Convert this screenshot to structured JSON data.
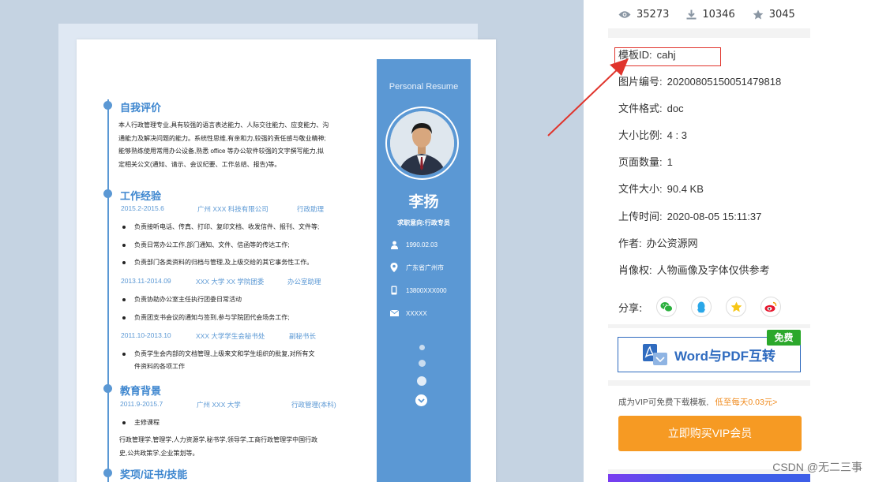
{
  "stats": {
    "views": "35273",
    "downloads": "10346",
    "favorites": "3045"
  },
  "details": [
    {
      "label": "模板ID:",
      "value": "cahj"
    },
    {
      "label": "图片编号:",
      "value": "20200805150051479818"
    },
    {
      "label": "文件格式:",
      "value": "doc"
    },
    {
      "label": "大小比例:",
      "value": "4 : 3"
    },
    {
      "label": "页面数量:",
      "value": "1"
    },
    {
      "label": "文件大小:",
      "value": "90.4 KB"
    },
    {
      "label": "上传时间:",
      "value": "2020-08-05 15:11:37"
    },
    {
      "label": "作者:",
      "value": "办公资源网"
    },
    {
      "label": "肖像权:",
      "value": "人物画像及字体仅供参考"
    }
  ],
  "share": {
    "label": "分享:",
    "targets": [
      "wechat-icon",
      "qq-icon",
      "qzone-icon",
      "weibo-icon"
    ]
  },
  "convert": {
    "label": "Word与PDF互转",
    "badge": "免费"
  },
  "vip": {
    "note": "成为VIP可免费下载模板,",
    "highlight": "低至每天0.03元>",
    "button": "立即购买VIP会员"
  },
  "watermark": "CSDN @无二三事",
  "colors": {
    "accent": "#5b98d4",
    "vip_orange": "#f69a23",
    "highlight_red": "#e0342c",
    "free_green": "#2ba82b"
  },
  "resume": {
    "side_title": "Personal Resume",
    "name": "李扬",
    "intent": "求职意向:行政专员",
    "birth": "1990.02.03",
    "location": "广东省广州市",
    "phone": "13800XXX000",
    "email": "XXXXX",
    "sections": {
      "self_eval": {
        "title": "自我评价",
        "lines": [
          "本人行政管理专业,具有较强的语言表达能力、人际交往能力、应变能力、沟",
          "通能力及解决问题的能力。系统性思维,有亲和力,较强的责任感与敬业精神;",
          "能够熟练使用常用办公设备,熟悉 office 等办公软件较强的文字撰写能力,拟",
          "定相关公文(通知、请示、会议纪要、工作总结、报告)等。"
        ]
      },
      "work": {
        "title": "工作经验",
        "jobs": [
          {
            "period": "2015.2-2015.6",
            "org": "广州 XXX 科技有限公司",
            "role": "行政助理",
            "items": [
              "负责接听电话、传真、打印、复印文档、收发信件、报刊、文件等;",
              "负责日常办公工作,部门通知、文件、信函等的传达工作;",
              "负责部门各类资料的归档与管理,及上级交给的其它事务性工作。"
            ]
          },
          {
            "period": "2013.11-2014.09",
            "org": "XXX 大学 XX 学院团委",
            "role": "办公室助理",
            "items": [
              "负责协助办公室主任执行团委日常活动",
              "负责团支书会议的通知与签到,参与学院团代会场务工作;"
            ]
          },
          {
            "period": "2011.10-2013.10",
            "org": "XXX 大学学生会秘书处",
            "role": "副秘书长",
            "items": [
              "负责学生会内部的文档管理,上级来文和学生组织的批复,对所有文",
              "件资料的各项工作"
            ]
          }
        ]
      },
      "edu": {
        "title": "教育背景",
        "period": "2011.9-2015.7",
        "school": "广州 XXX 大学",
        "major": "行政管理(本科)",
        "course_label": "主修课程",
        "courses": [
          "行政管理学,管理学,人力资源学,秘书学,领导学,工商行政管理学中国行政",
          "史,公共政策学,企业策划等。"
        ]
      },
      "awards": {
        "title": "奖项/证书/技能"
      }
    }
  }
}
